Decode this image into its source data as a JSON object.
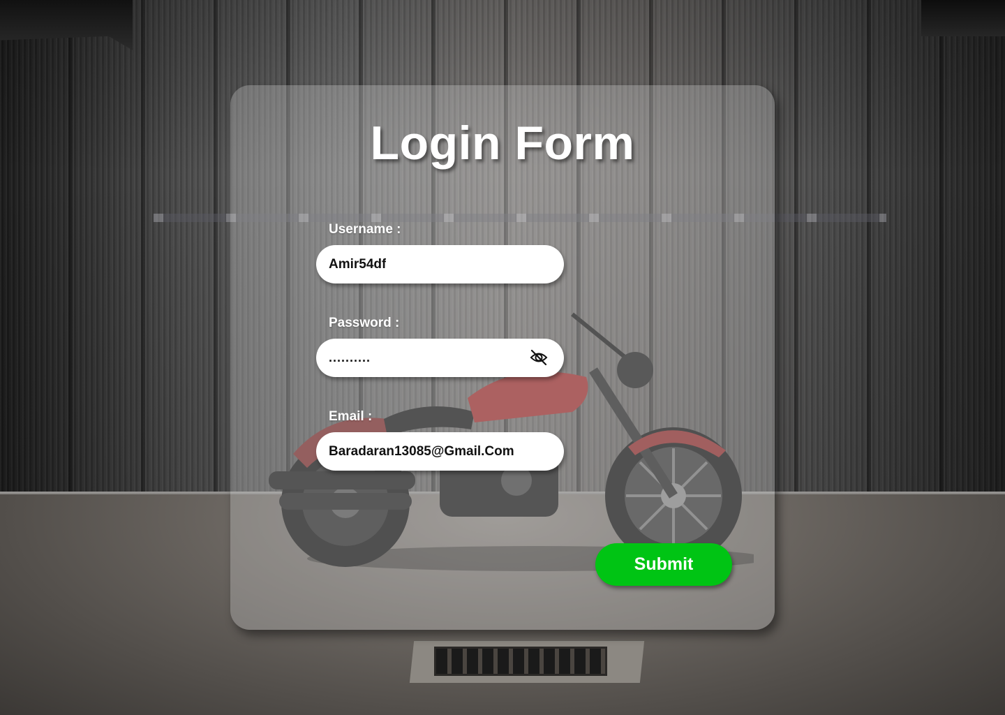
{
  "form": {
    "title": "Login Form",
    "username": {
      "label": "Username :",
      "value": "Amir54df"
    },
    "password": {
      "label": "Password :",
      "value": "..........",
      "toggle_icon": "eye-off-icon"
    },
    "email": {
      "label": "Email :",
      "value": "Baradaran13085@Gmail.Com"
    },
    "submit_label": "Submit"
  },
  "colors": {
    "card_background": "#cdcdcd",
    "submit_button": "#00c414",
    "field_background": "#ffffff",
    "text_light": "#ffffff",
    "text_dark": "#111111"
  }
}
